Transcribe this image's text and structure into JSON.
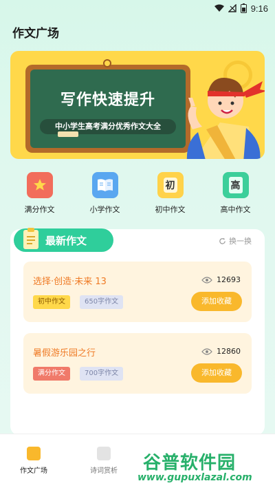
{
  "status_bar": {
    "time": "9:16"
  },
  "header": {
    "title": "作文广场"
  },
  "banner": {
    "title": "写作快速提升",
    "subtitle": "中小学生高考满分优秀作文大全"
  },
  "categories": [
    {
      "label": "满分作文",
      "icon": "star-book-icon",
      "color": "#f26d5b"
    },
    {
      "label": "小学作文",
      "icon": "open-book-icon",
      "color": "#5aa7f0"
    },
    {
      "label": "初中作文",
      "icon_text": "初",
      "label2": "初中作文",
      "color": "#ffd24a"
    },
    {
      "label": "高中作文",
      "icon_text": "高",
      "color": "#3ccf9a"
    }
  ],
  "latest": {
    "heading": "最新作文",
    "refresh_label": "换一换",
    "items": [
      {
        "title": "选择·创造·未来 13",
        "views": "12693",
        "tag1": "初中作文",
        "tag2": "650字作文",
        "button": "添加收藏"
      },
      {
        "title": "暑假游乐园之行",
        "views": "12860",
        "tag1": "满分作文",
        "tag2": "700字作文",
        "button": "添加收藏"
      }
    ]
  },
  "bottom_nav": {
    "items": [
      {
        "label": "作文广场",
        "active": true
      },
      {
        "label": "诗词赏析",
        "active": false
      }
    ]
  },
  "watermark": {
    "title": "谷普软件园",
    "url": "www.gupuxlazal.com"
  },
  "colors": {
    "accent": "#2fce9b",
    "banner_bg": "#ffd84a",
    "button": "#f9b82c",
    "card_title": "#ef7a25"
  }
}
